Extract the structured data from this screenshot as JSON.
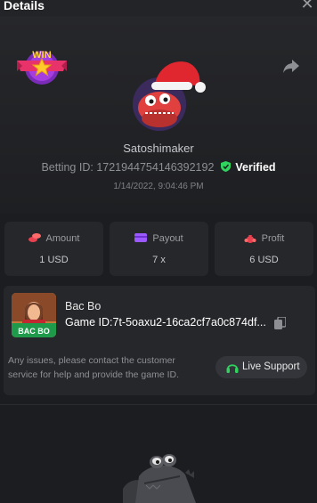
{
  "header": {
    "title": "Details",
    "close_icon": "close-icon"
  },
  "profile": {
    "badge_text": "WIN",
    "username": "Satoshimaker",
    "betting_id_label": "Betting ID:",
    "betting_id": "172194475414639219​2",
    "verified_label": "Verified",
    "datetime": "1/14/2022, 9:04:46 PM"
  },
  "stats": [
    {
      "label": "Amount",
      "value": "1 USD",
      "icon": "coins-icon"
    },
    {
      "label": "Payout",
      "value": "7 x",
      "icon": "wallet-icon"
    },
    {
      "label": "Profit",
      "value": "6 USD",
      "icon": "money-bag-icon"
    }
  ],
  "game": {
    "thumb_text": "BAC BO",
    "name": "Bac Bo",
    "id_label": "Game ID:",
    "id_value": "7t-5oaxu2-16ca2cf7a0c874df...",
    "issue_text": "Any issues, please contact the customer service for help and provide the game ID.",
    "support_label": "Live Support"
  },
  "colors": {
    "background": "#1c1d20",
    "card": "#26272a",
    "verified_green": "#2fd35e",
    "accent_red": "#e8414f",
    "accent_purple": "#9b59ff"
  }
}
